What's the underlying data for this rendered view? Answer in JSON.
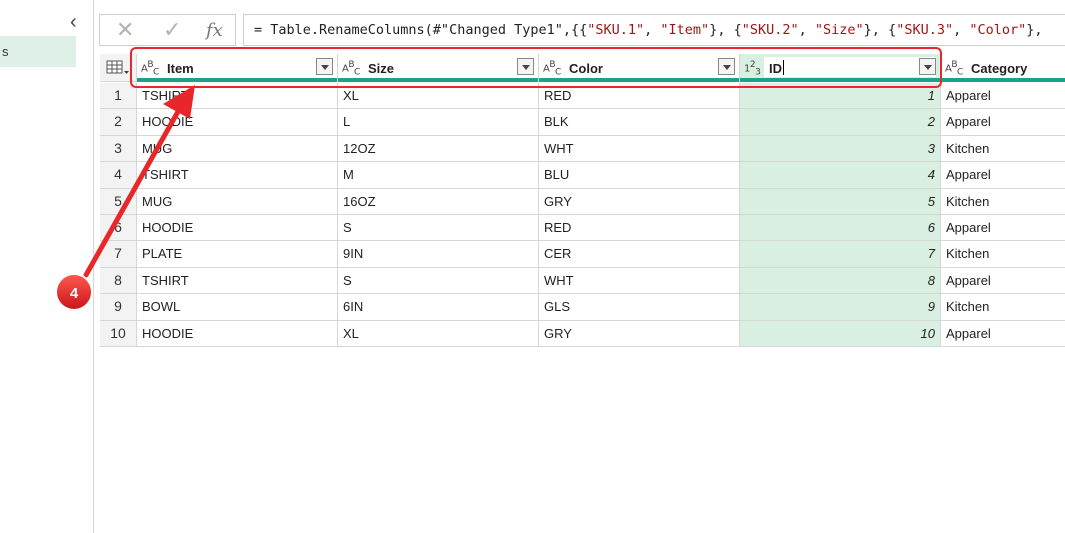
{
  "queries_pane": {
    "collapse_glyph": "‹",
    "selected_query_label": "s"
  },
  "formula_bar": {
    "cancel_glyph": "✕",
    "commit_glyph": "✓",
    "fx_glyph": "fx",
    "prefix": "= Table.RenameColumns(#\"Changed Type1\",{{",
    "s1": "\"SKU.1\"",
    "t1": ", ",
    "s2": "\"Item\"",
    "t2": "}, {",
    "s3": "\"SKU.2\"",
    "t3": ", ",
    "s4": "\"Size\"",
    "t4": "}, {",
    "s5": "\"SKU.3\"",
    "t5": ", ",
    "s6": "\"Color\"",
    "t6": "},"
  },
  "columns": [
    {
      "type_icon": "ABC",
      "name": "Item"
    },
    {
      "type_icon": "ABC",
      "name": "Size"
    },
    {
      "type_icon": "ABC",
      "name": "Color"
    },
    {
      "type_icon": "123",
      "name": "ID"
    },
    {
      "type_icon": "ABC",
      "name": "Category"
    }
  ],
  "rows": [
    {
      "n": "1",
      "item": "TSHIRT",
      "size": "XL",
      "color": "RED",
      "id": "1",
      "category": "Apparel"
    },
    {
      "n": "2",
      "item": "HOODIE",
      "size": "L",
      "color": "BLK",
      "id": "2",
      "category": "Apparel"
    },
    {
      "n": "3",
      "item": "MUG",
      "size": "12OZ",
      "color": "WHT",
      "id": "3",
      "category": "Kitchen"
    },
    {
      "n": "4",
      "item": "TSHIRT",
      "size": "M",
      "color": "BLU",
      "id": "4",
      "category": "Apparel"
    },
    {
      "n": "5",
      "item": "MUG",
      "size": "16OZ",
      "color": "GRY",
      "id": "5",
      "category": "Kitchen"
    },
    {
      "n": "6",
      "item": "HOODIE",
      "size": "S",
      "color": "RED",
      "id": "6",
      "category": "Apparel"
    },
    {
      "n": "7",
      "item": "PLATE",
      "size": "9IN",
      "color": "CER",
      "id": "7",
      "category": "Kitchen"
    },
    {
      "n": "8",
      "item": "TSHIRT",
      "size": "S",
      "color": "WHT",
      "id": "8",
      "category": "Apparel"
    },
    {
      "n": "9",
      "item": "BOWL",
      "size": "6IN",
      "color": "GLS",
      "id": "9",
      "category": "Kitchen"
    },
    {
      "n": "10",
      "item": "HOODIE",
      "size": "XL",
      "color": "GRY",
      "id": "10",
      "category": "Apparel"
    }
  ],
  "annotation": {
    "step_number": "4",
    "color": "#e8272a"
  },
  "colors": {
    "header_underline": "#1aa28a",
    "numeric_column_bg": "#d9efe2",
    "selected_query_bg": "#dff0e6"
  }
}
